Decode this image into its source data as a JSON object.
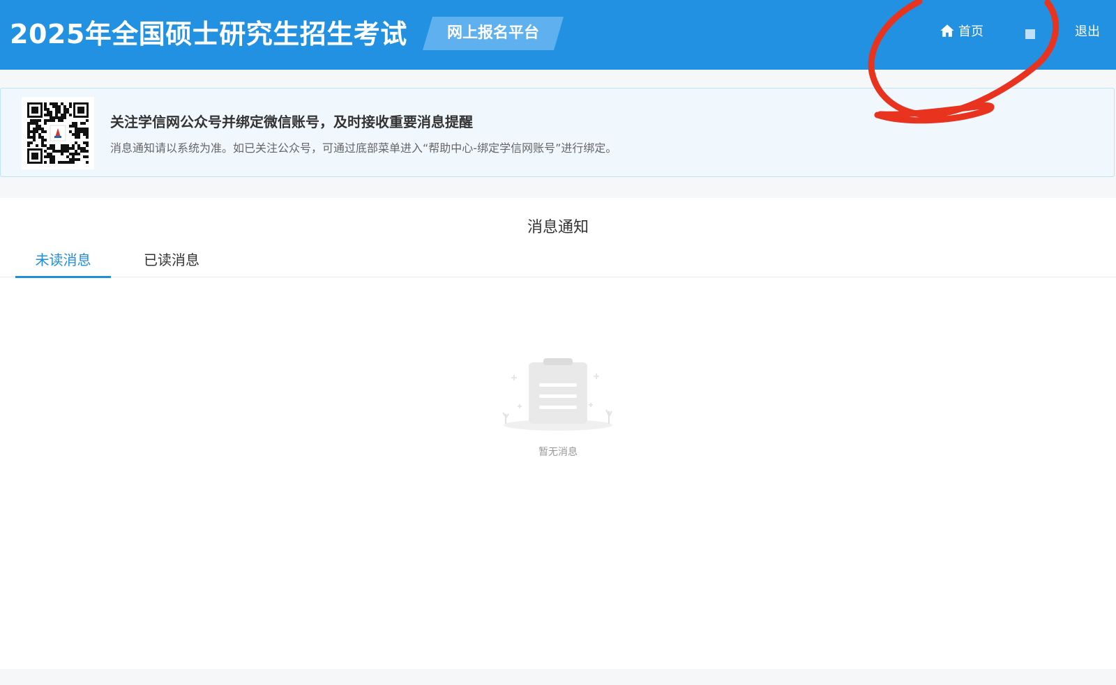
{
  "header": {
    "title": "2025年全国硕士研究生招生考试",
    "platform_label": "网上报名平台",
    "nav": {
      "home_icon": "home-icon",
      "home_label": "首页",
      "logout_label": "退出"
    }
  },
  "notice": {
    "qr_icon": "qr-code",
    "title": "关注学信网公众号并绑定微信账号，及时接收重要消息提醒",
    "description": "消息通知请以系统为准。如已关注公众号，可通过底部菜单进入“帮助中心-绑定学信网账号”进行绑定。"
  },
  "messages": {
    "title": "消息通知",
    "tabs": [
      {
        "label": "未读消息",
        "active": true
      },
      {
        "label": "已读消息",
        "active": false
      }
    ],
    "empty_icon": "empty-clipboard-icon",
    "empty_text": "暂无消息"
  },
  "colors": {
    "header_bg": "#2391e2",
    "badge_bg": "#5fb0ee",
    "active_tab": "#1f8ed9",
    "annotation": "#e8331f"
  }
}
